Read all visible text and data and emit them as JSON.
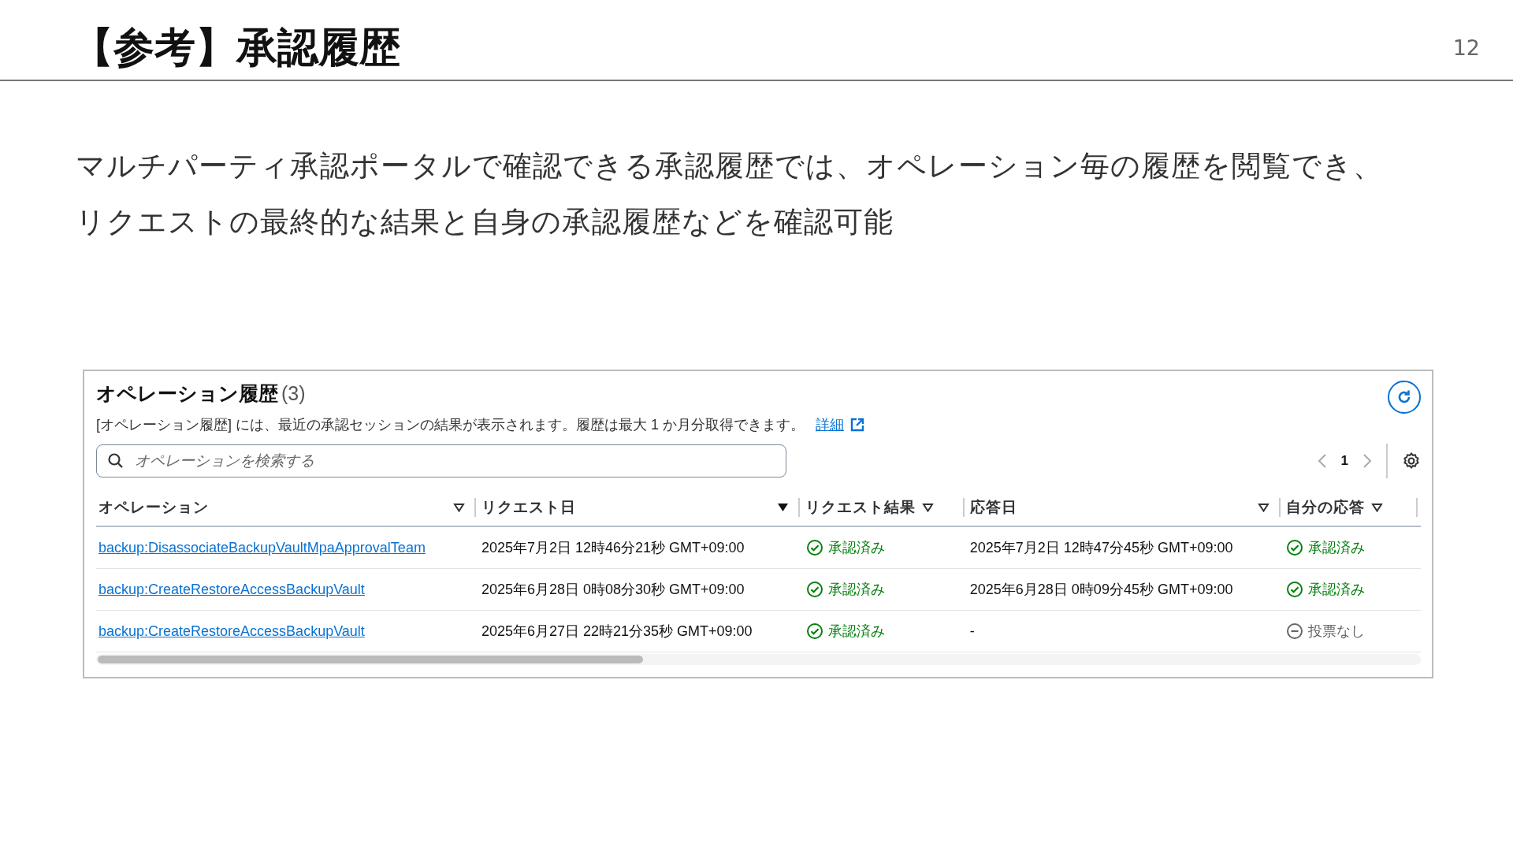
{
  "slide": {
    "title": "【参考】承認履歴",
    "page_number": "12",
    "body_lines": [
      "マルチパーティ承認ポータルで確認できる承認履歴では、オペレーション毎の履歴を閲覧でき、",
      "リクエストの最終的な結果と自身の承認履歴などを確認可能"
    ]
  },
  "panel": {
    "title": "オペレーション履歴",
    "count": "(3)",
    "description": "[オペレーション履歴] には、最近の承認セッションの結果が表示されます。履歴は最大 1 か月分取得できます。",
    "link": "詳細",
    "search": {
      "placeholder": "オペレーションを検索する"
    },
    "page": "1",
    "columns": [
      {
        "label": "オペレーション",
        "sorted": false
      },
      {
        "label": "リクエスト日",
        "sorted": true
      },
      {
        "label": "リクエスト結果",
        "sorted": false
      },
      {
        "label": "応答日",
        "sorted": false
      },
      {
        "label": "自分の応答",
        "sorted": false
      }
    ],
    "rows": [
      {
        "operation": "backup:DisassociateBackupVaultMpaApprovalTeam",
        "request_date": "2025年7月2日 12時46分21秒 GMT+09:00",
        "result": {
          "kind": "approved",
          "text": "承認済み"
        },
        "response_date": "2025年7月2日 12時47分45秒 GMT+09:00",
        "my_response": {
          "kind": "approved",
          "text": "承認済み"
        }
      },
      {
        "operation": "backup:CreateRestoreAccessBackupVault",
        "request_date": "2025年6月28日 0時08分30秒 GMT+09:00",
        "result": {
          "kind": "approved",
          "text": "承認済み"
        },
        "response_date": "2025年6月28日 0時09分45秒 GMT+09:00",
        "my_response": {
          "kind": "approved",
          "text": "承認済み"
        }
      },
      {
        "operation": "backup:CreateRestoreAccessBackupVault",
        "request_date": "2025年6月27日 22時21分35秒 GMT+09:00",
        "result": {
          "kind": "approved",
          "text": "承認済み"
        },
        "response_date": "-",
        "my_response": {
          "kind": "none",
          "text": "投票なし"
        }
      }
    ]
  }
}
